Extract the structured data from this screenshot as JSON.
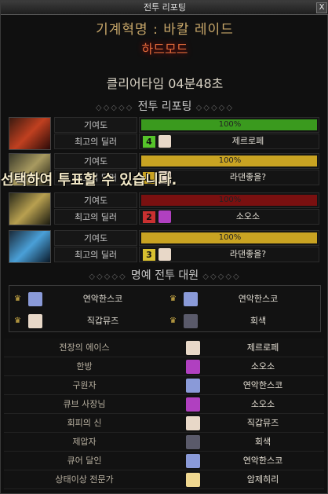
{
  "window": {
    "title": "전투 리포팅",
    "close_label": "X"
  },
  "dungeon_title": "기계혁명 : 바칼 레이드",
  "mode": "하드모드",
  "clear_time": "클리어타임  04분48초",
  "section_report": "전투 리포팅",
  "section_honor": "명예 전투 대원",
  "overlay_text": "선택하여 투표할 수 있습니다.",
  "labels": {
    "contribution": "기여도",
    "best_dealer": "최고의 딜러"
  },
  "colors": {
    "green": "#3a9a1e",
    "yellow": "#c9a322",
    "red": "#7a1010",
    "bg": "#101010"
  },
  "report": [
    {
      "icon": "flame-raid-icon",
      "contribution_text": "100%",
      "contribution_pct": 100,
      "bar_color": "green",
      "rank": "4",
      "rank_color": "#56c32a",
      "dealer": "제르로페"
    },
    {
      "icon": "shield-raid-icon",
      "contribution_text": "100%",
      "contribution_pct": 100,
      "bar_color": "yellow",
      "rank": "1",
      "rank_color": "#c9a322",
      "dealer": "라댄좋을?"
    },
    {
      "icon": "gold-raid-icon",
      "contribution_text": "100%",
      "contribution_pct": 100,
      "bar_color": "red",
      "rank": "2",
      "rank_color": "#c83030",
      "dealer": "소오소"
    },
    {
      "icon": "blue-raid-icon",
      "contribution_text": "100%",
      "contribution_pct": 100,
      "bar_color": "yellow",
      "rank": "3",
      "rank_color": "#d8c030",
      "dealer": "라댄좋을?"
    }
  ],
  "honor": [
    {
      "name": "연악한스코"
    },
    {
      "name": "연악한스코"
    },
    {
      "name": "직갑뮤즈"
    },
    {
      "name": "회색"
    }
  ],
  "awards": [
    {
      "title": "전장의 에이스",
      "name": "제르로페"
    },
    {
      "title": "한방",
      "name": "소오소"
    },
    {
      "title": "구원자",
      "name": "연악한스코"
    },
    {
      "title": "큐브 사장님",
      "name": "소오소"
    },
    {
      "title": "회피의 신",
      "name": "직갑뮤즈"
    },
    {
      "title": "제압자",
      "name": "회색"
    },
    {
      "title": "큐어 달인",
      "name": "연악한스코"
    },
    {
      "title": "상태이상 전문가",
      "name": "암제히리"
    }
  ]
}
